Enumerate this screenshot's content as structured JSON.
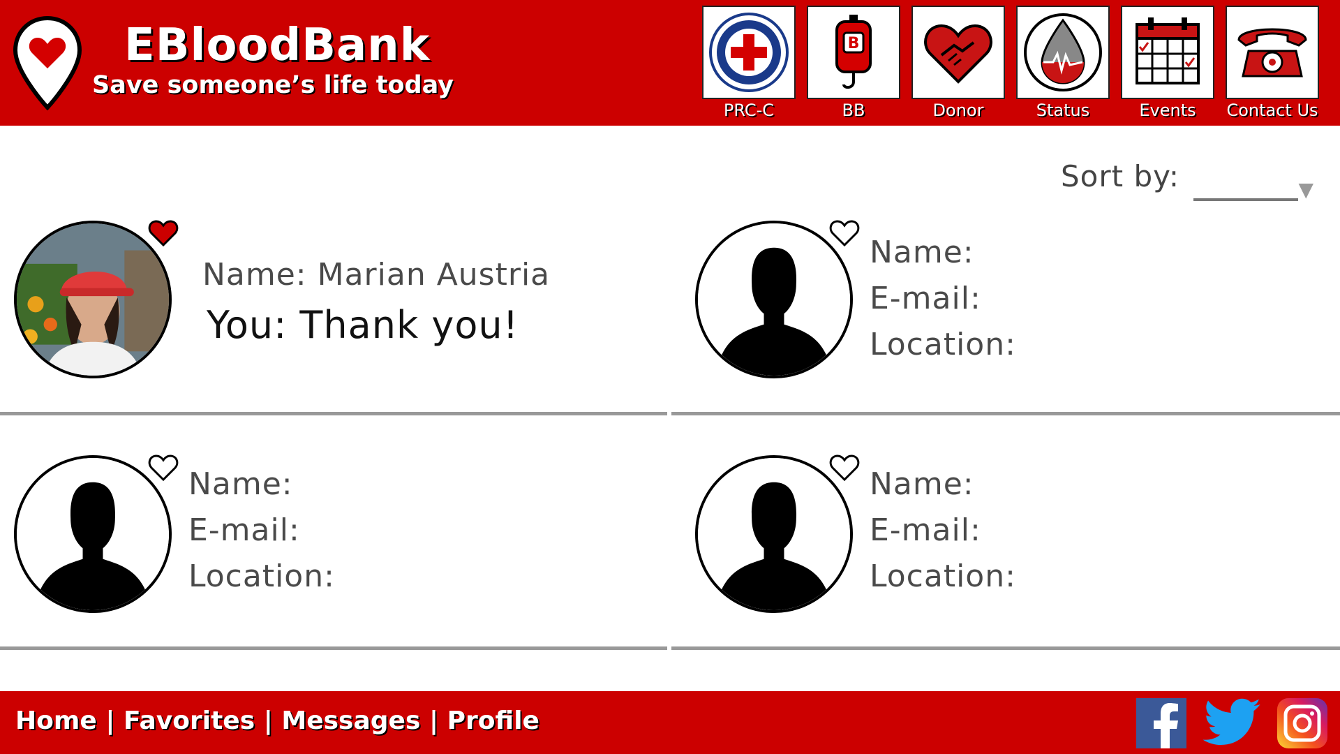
{
  "app": {
    "title": "EBloodBank",
    "tagline": "Save someone’s life today"
  },
  "nav": [
    {
      "label": "PRC-C",
      "icon": "red-cross-icon",
      "badge_text": "THE PHILIPPINE NATIONAL RED CROSS"
    },
    {
      "label": "BB",
      "icon": "blood-bag-icon",
      "badge_text": "B"
    },
    {
      "label": "Donor",
      "icon": "heart-handshake-icon"
    },
    {
      "label": "Status",
      "icon": "blood-drop-icon"
    },
    {
      "label": "Events",
      "icon": "calendar-icon"
    },
    {
      "label": "Contact Us",
      "icon": "telephone-icon"
    }
  ],
  "sort": {
    "label": "Sort by:",
    "value": ""
  },
  "cards": [
    {
      "name_label": "Name: Marian Austria",
      "message": "You: Thank you!",
      "favorited": true,
      "has_photo": true
    },
    {
      "name_label": "Name:",
      "email_label": "E-mail:",
      "location_label": "Location:",
      "favorited": false,
      "has_photo": false
    },
    {
      "name_label": "Name:",
      "email_label": "E-mail:",
      "location_label": "Location:",
      "favorited": false,
      "has_photo": false
    },
    {
      "name_label": "Name:",
      "email_label": "E-mail:",
      "location_label": "Location:",
      "favorited": false,
      "has_photo": false
    }
  ],
  "footer": {
    "links": [
      "Home",
      "Favorites",
      "Messages",
      "Profile"
    ],
    "separator": "|",
    "social": [
      "facebook-icon",
      "twitter-icon",
      "instagram-icon"
    ]
  },
  "colors": {
    "brand_red": "#cc0000",
    "divider": "#999999",
    "text": "#4a4a4a"
  }
}
